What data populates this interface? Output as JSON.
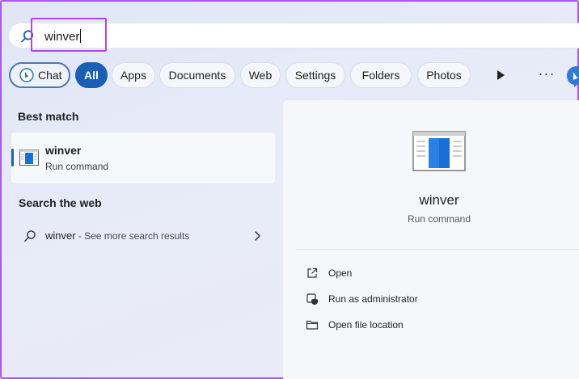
{
  "search": {
    "query": "winver"
  },
  "filters": {
    "chat_label": "Chat",
    "items": [
      "All",
      "Apps",
      "Documents",
      "Web",
      "Settings",
      "Folders",
      "Photos"
    ],
    "selected": "All",
    "more_label": "···"
  },
  "best_match": {
    "section_title": "Best match",
    "name": "winver",
    "type": "Run command"
  },
  "web": {
    "section_title": "Search the web",
    "query": "winver",
    "suffix": " - See more search results"
  },
  "detail": {
    "name": "winver",
    "type": "Run command",
    "actions": [
      "Open",
      "Run as administrator",
      "Open file location"
    ]
  },
  "colors": {
    "accent": "#1a5fb4",
    "highlight_box": "#b048e8",
    "frame": "#a855f7"
  },
  "icons": {
    "search": "search-icon",
    "bing_chat": "bing-chat-icon",
    "play": "play-icon",
    "copilot": "copilot-icon",
    "app": "winver-app-icon",
    "open": "open-external-icon",
    "admin": "shield-admin-icon",
    "folder": "folder-icon"
  }
}
